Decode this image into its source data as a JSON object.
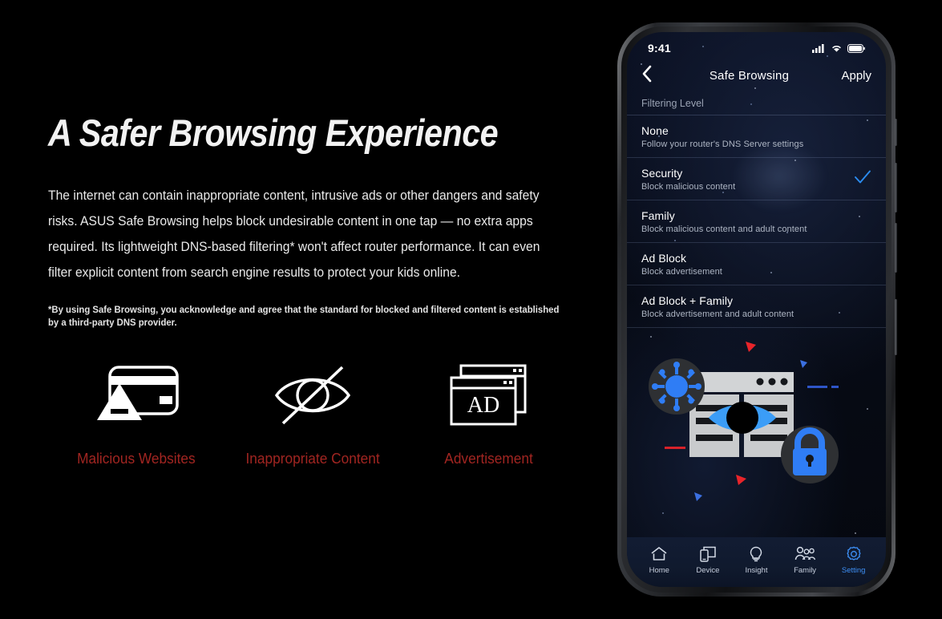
{
  "promo": {
    "headline": "A Safer Browsing Experience",
    "body": "The internet can contain inappropriate content, intrusive ads or other dangers and safety risks. ASUS Safe Browsing helps block undesirable content in one tap — no extra apps required. Its lightweight DNS-based filtering* won't affect router performance. It can even filter explicit content from search engine results to protect your kids online.",
    "footnote": "*By using Safe Browsing, you acknowledge and agree that the standard for blocked and filtered content is established by a third-party DNS provider.",
    "label_color": "#a12521",
    "features": [
      {
        "icon": "credit-card-warning-icon",
        "label": "Malicious Websites"
      },
      {
        "icon": "eye-slash-icon",
        "label": "Inappropriate Content"
      },
      {
        "icon": "ad-windows-icon",
        "label": "Advertisement"
      }
    ]
  },
  "phone": {
    "status": {
      "time": "9:41",
      "signal_icon": "cellular-signal-icon",
      "wifi_icon": "wifi-icon",
      "battery_icon": "battery-icon"
    },
    "nav": {
      "back_icon": "chevron-left-icon",
      "title": "Safe Browsing",
      "apply_label": "Apply"
    },
    "section_title": "Filtering Level",
    "selected_option": "Security",
    "check_icon": "checkmark-icon",
    "check_color": "#2b8cf0",
    "options": [
      {
        "title": "None",
        "subtitle": "Follow your router's DNS  Server settings",
        "selected": false
      },
      {
        "title": "Security",
        "subtitle": "Block malicious content",
        "selected": true
      },
      {
        "title": "Family",
        "subtitle": "Block malicious content and adult content",
        "selected": false
      },
      {
        "title": "Ad Block",
        "subtitle": "Block advertisement",
        "selected": false
      },
      {
        "title": "Ad Block + Family",
        "subtitle": "Block advertisement and adult content",
        "selected": false
      }
    ],
    "illustration": {
      "name": "safe-browsing-illustration",
      "badges": [
        "virus-icon",
        "lock-icon"
      ],
      "accent_blue": "#2f7df5",
      "accent_red": "#e8242a"
    },
    "tabs": [
      {
        "icon": "home-icon",
        "label": "Home",
        "active": false
      },
      {
        "icon": "device-icon",
        "label": "Device",
        "active": false
      },
      {
        "icon": "insight-bulb-icon",
        "label": "Insight",
        "active": false
      },
      {
        "icon": "family-icon",
        "label": "Family",
        "active": false
      },
      {
        "icon": "setting-gear-icon",
        "label": "Setting",
        "active": true
      }
    ],
    "active_tab": "Setting"
  }
}
